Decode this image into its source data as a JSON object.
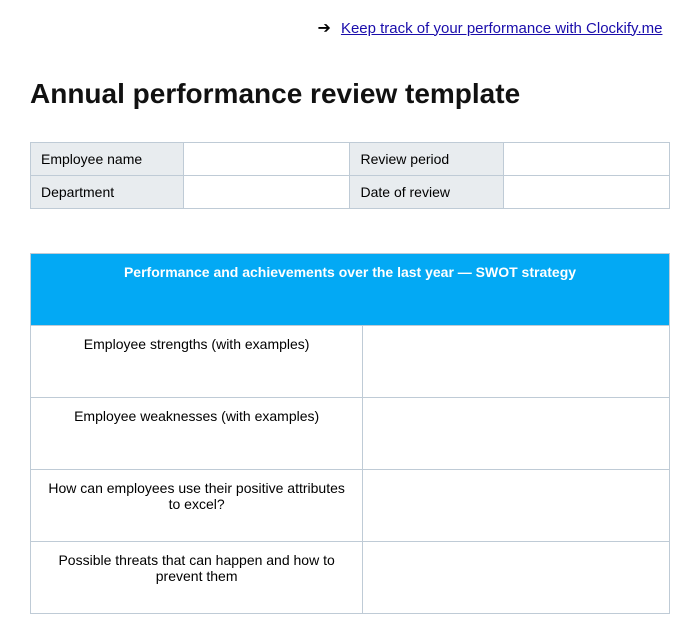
{
  "header": {
    "link_text": "Keep track of your performance with Clockify.me"
  },
  "title": "Annual performance review template",
  "info": {
    "rows": [
      {
        "label1": "Employee name",
        "value1": "",
        "label2": "Review period",
        "value2": ""
      },
      {
        "label1": "Department",
        "value1": "",
        "label2": "Date of review",
        "value2": ""
      }
    ]
  },
  "swot": {
    "header": "Performance and achievements over the last year — SWOT strategy",
    "rows": [
      {
        "label": "Employee strengths (with examples)",
        "value": ""
      },
      {
        "label": "Employee weaknesses (with examples)",
        "value": ""
      },
      {
        "label": "How can employees use their positive attributes to excel?",
        "value": ""
      },
      {
        "label": "Possible threats that can happen and how to prevent them",
        "value": ""
      }
    ]
  }
}
